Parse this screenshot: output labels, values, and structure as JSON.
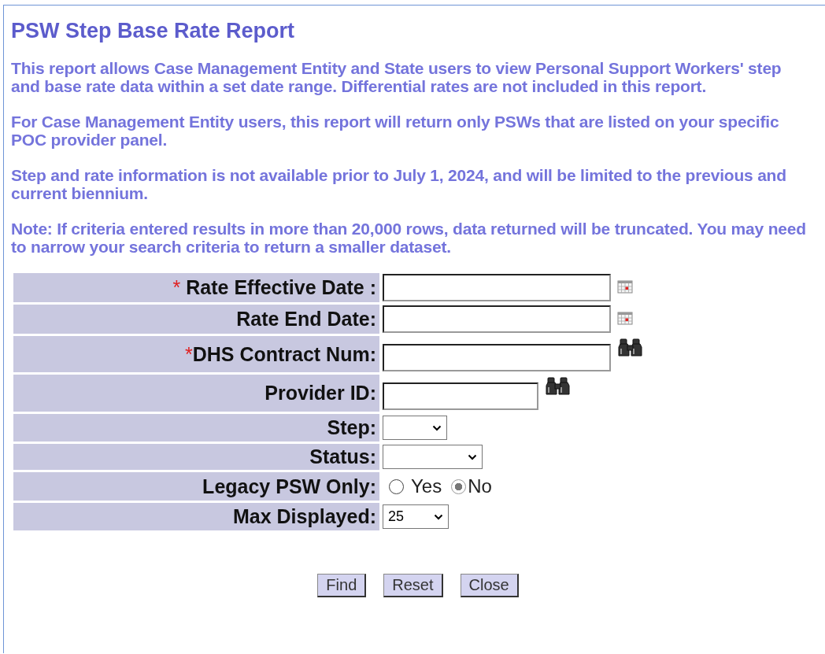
{
  "title": "PSW Step Base Rate Report",
  "paragraphs": [
    "This report allows Case Management Entity and State users to view Personal Support Workers' step and base rate data within a set date range. Differential rates are not included in this report.",
    "For Case Management Entity users, this report will return only PSWs that are listed on your specific POC provider panel.",
    "Step and rate information is not available prior to July 1, 2024, and will be limited to the previous and current biennium.",
    "Note: If criteria entered results in more than 20,000 rows, data returned will be truncated. You may need to narrow your search criteria to return a smaller dataset."
  ],
  "fields": [
    {
      "kind": "date",
      "asterisk": "* ",
      "label": "Rate Effective Date :"
    },
    {
      "kind": "date",
      "label": "Rate End Date:"
    },
    {
      "kind": "lookup",
      "asterisk": "*",
      "label": "DHS Contract Num:"
    },
    {
      "kind": "lookup",
      "label": "Provider ID:"
    },
    {
      "kind": "select",
      "label": "Step:"
    },
    {
      "kind": "select",
      "label": "Status:"
    },
    {
      "kind": "radio",
      "label": "Legacy PSW Only:",
      "options": [
        {
          "label": "Yes",
          "selected": false
        },
        {
          "label": "No",
          "selected": true
        }
      ]
    },
    {
      "kind": "select",
      "label": "Max Displayed:",
      "value": "25"
    }
  ],
  "buttons": [
    "Find",
    "Reset",
    "Close"
  ]
}
